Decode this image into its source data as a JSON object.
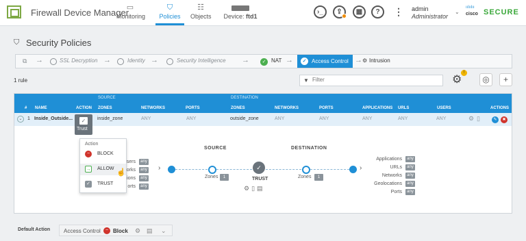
{
  "header": {
    "app_title": "Firewall Device Manager",
    "nav": [
      {
        "label": "Monitoring",
        "icon": "monitor-icon"
      },
      {
        "label": "Policies",
        "icon": "policies-icon",
        "active": true
      },
      {
        "label": "Objects",
        "icon": "objects-icon"
      }
    ],
    "device_label": "Device: ",
    "device_name": "ftd1",
    "user_name": "admin",
    "user_role": "Administrator",
    "brand_cisco": "cisco",
    "brand_secure": "SECURE"
  },
  "page": {
    "title": "Security Policies"
  },
  "flow": {
    "steps": [
      "SSL Decryption",
      "Identity",
      "Security Intelligence",
      "NAT",
      "Access Control",
      "Intrusion"
    ],
    "active": "Access Control"
  },
  "toolbar": {
    "rule_count": "1 rule",
    "filter_placeholder": "Filter",
    "settings_badge": "!"
  },
  "table": {
    "group_headers": {
      "source": "SOURCE",
      "destination": "DESTINATION"
    },
    "columns": [
      "#",
      "NAME",
      "ACTION",
      "ZONES",
      "NETWORKS",
      "PORTS",
      "ZONES",
      "NETWORKS",
      "PORTS",
      "APPLICATIONS",
      "URLS",
      "USERS",
      "ACTIONS"
    ],
    "rows": [
      {
        "num": "1",
        "name": "Inside_Outside...",
        "action": "Trust",
        "src_zones": "inside_zone",
        "src_networks": "ANY",
        "src_ports": "ANY",
        "dst_zones": "outside_zone",
        "dst_networks": "ANY",
        "dst_ports": "ANY",
        "applications": "ANY",
        "urls": "ANY",
        "users": "ANY"
      }
    ]
  },
  "detail": {
    "source_head": "SOURCE",
    "destination_head": "DESTINATION",
    "left_attrs": [
      "sers",
      "works",
      "ations",
      "orts"
    ],
    "any": "any",
    "zones_label": "Zones",
    "src_zone_count": "1",
    "dst_zone_count": "1",
    "trust_label": "TRUST",
    "right_attrs": [
      "Applications",
      "URLs",
      "Networks",
      "Geolocations",
      "Ports"
    ]
  },
  "action_menu": {
    "title": "Action",
    "items": [
      {
        "label": "BLOCK",
        "color": "#d0342c"
      },
      {
        "label": "ALLOW",
        "color": "#4caf50"
      },
      {
        "label": "TRUST",
        "color": "#8a939a"
      }
    ]
  },
  "footer": {
    "label": "Default Action",
    "policy": "Access Control",
    "action": "Block"
  }
}
